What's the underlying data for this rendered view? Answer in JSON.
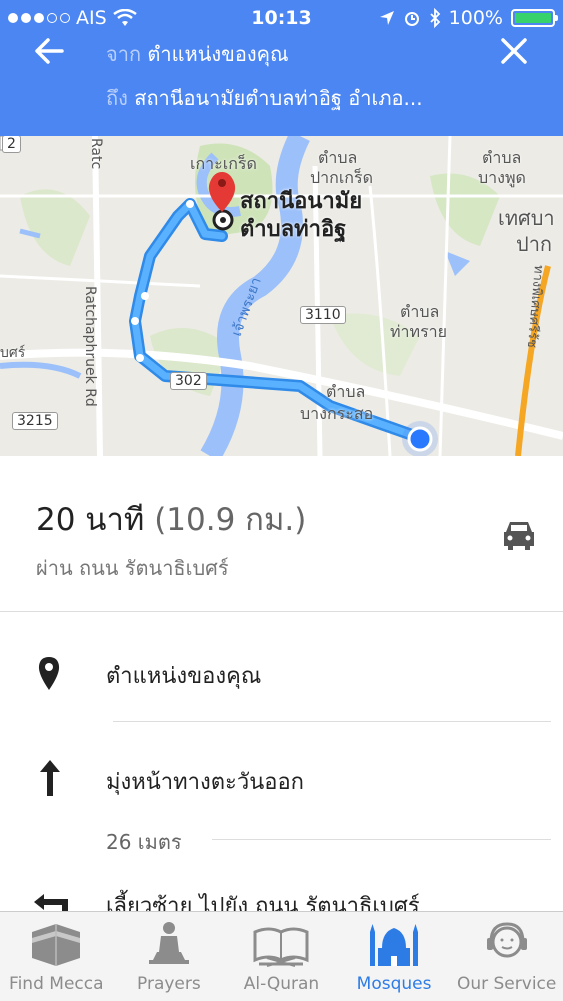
{
  "status": {
    "carrier": "AIS",
    "time": "10:13",
    "battery": "100%"
  },
  "header": {
    "from_label": "จาก",
    "from_value": "ตำแหน่งของคุณ",
    "to_label": "ถึง",
    "to_value": "สถานีอนามัยตำบลท่าอิฐ อำเภอ...",
    "back_icon": "back-arrow-icon",
    "close_icon": "close-icon"
  },
  "map": {
    "destination_line1": "สถานีอนามัย",
    "destination_line2": "ตำบลท่าอิฐ",
    "labels": {
      "kokkret": "เกาะเกร็ด",
      "pakkret1": "ตำบล",
      "pakkret2": "ปากเกร็ด",
      "bangphut1": "ตำบล",
      "bangphut2": "บางพูด",
      "thesaban1": "เทศบา",
      "thesaban2": "ปาก",
      "thasai1": "ตำบล",
      "thasai2": "ท่าทราย",
      "bangkraso1": "ตำบล",
      "bangkraso2": "บางกระสอ",
      "river": "เจ้าพระยา",
      "ratchaphruek": "Ratchaphruek Rd",
      "ratcha_top": "Ratc",
      "thiphawet": "ทางพิเศษศรีรัช",
      "left_edge": "บศร์"
    },
    "roads": {
      "r3110": "3110",
      "r302": "302",
      "r3215": "3215",
      "r2": "2"
    }
  },
  "summary": {
    "duration": "20 นาที",
    "distance": "(10.9 กม.)",
    "via": "ผ่าน ถนน รัตนาธิเบศร์",
    "mode_icon": "car-icon"
  },
  "steps": [
    {
      "text": "ตำแหน่งของคุณ",
      "icon": "location-pin-icon"
    },
    {
      "text": "มุ่งหน้าทางตะวันออก",
      "sub": "26 เมตร",
      "icon": "arrow-up-icon"
    },
    {
      "text": "เลี้ยวซ้าย ไปยัง ถนน รัตนาธิเบศร์",
      "icon": "turn-left-icon"
    }
  ],
  "tabs": [
    {
      "label": "Find Mecca",
      "icon": "kaaba-icon",
      "active": false
    },
    {
      "label": "Prayers",
      "icon": "prayer-person-icon",
      "active": false
    },
    {
      "label": "Al-Quran",
      "icon": "quran-book-icon",
      "active": false
    },
    {
      "label": "Mosques",
      "icon": "mosque-icon",
      "active": true
    },
    {
      "label": "Our Service",
      "icon": "support-agent-icon",
      "active": false
    }
  ],
  "colors": {
    "header": "#4b86f2",
    "route": "#3a9af2",
    "active_tab": "#2d7ce6",
    "pin": "#e53935"
  }
}
